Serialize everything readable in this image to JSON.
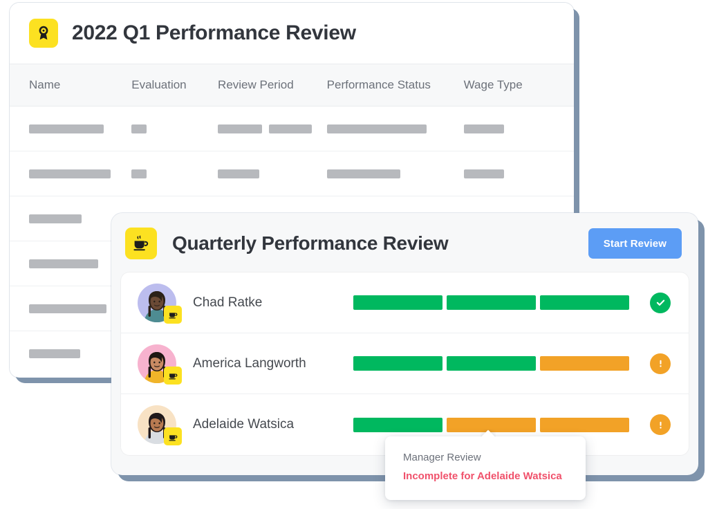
{
  "table_card": {
    "icon": "award-ribbon-icon",
    "icon_tile_color": "#FCE121",
    "title": "2022 Q1 Performance Review",
    "columns": [
      "Name",
      "Evaluation",
      "Review Period",
      "Performance Status",
      "Wage Type"
    ],
    "placeholder_rows": [
      {
        "cells": [
          [
            108
          ],
          [
            22
          ],
          [
            64,
            62
          ],
          [
            144
          ],
          [
            58
          ]
        ]
      },
      {
        "cells": [
          [
            118
          ],
          [
            22
          ],
          [
            60
          ],
          [
            106
          ],
          [
            58
          ]
        ]
      },
      {
        "cells": [
          [
            76
          ],
          [],
          [],
          [],
          []
        ]
      },
      {
        "cells": [
          [
            100
          ],
          [],
          [],
          [],
          []
        ]
      },
      {
        "cells": [
          [
            112
          ],
          [],
          [],
          [],
          []
        ]
      },
      {
        "cells": [
          [
            74
          ],
          [],
          [],
          [],
          []
        ]
      }
    ]
  },
  "review_card": {
    "icon": "coffee-cup-icon",
    "icon_tile_color": "#FCE121",
    "title": "Quarterly Performance Review",
    "start_button_label": "Start Review",
    "start_button_color": "#5C9DF5",
    "green": "#00B85F",
    "orange": "#F2A227",
    "people": [
      {
        "name": "Chad Ratke",
        "avatar_bg": "#BCBDEE",
        "avatar_skin": "#6B4A35",
        "avatar_hair": "#2B2118",
        "avatar_shirt": "#4E8C92",
        "badge_icon": "coffee-cup-icon",
        "segments": [
          "green",
          "green",
          "green"
        ],
        "status": "complete",
        "status_icon": "check-circle-icon"
      },
      {
        "name": "America Langworth",
        "avatar_bg": "#F7B2CE",
        "avatar_skin": "#C98A63",
        "avatar_hair": "#1E1713",
        "avatar_shirt": "#F0B429",
        "badge_icon": "coffee-cup-icon",
        "segments": [
          "green",
          "green",
          "orange"
        ],
        "status": "incomplete",
        "status_icon": "alert-circle-icon"
      },
      {
        "name": "Adelaide Watsica",
        "avatar_bg": "#F8E2C4",
        "avatar_skin": "#B87A51",
        "avatar_hair": "#20181A",
        "avatar_shirt": "#D9DDE2",
        "badge_icon": "coffee-cup-icon",
        "segments": [
          "green",
          "orange",
          "orange"
        ],
        "status": "incomplete",
        "status_icon": "alert-circle-icon"
      }
    ]
  },
  "tooltip": {
    "title": "Manager Review",
    "message": "Incomplete for Adelaide Watsica",
    "message_color": "#F0516B"
  }
}
